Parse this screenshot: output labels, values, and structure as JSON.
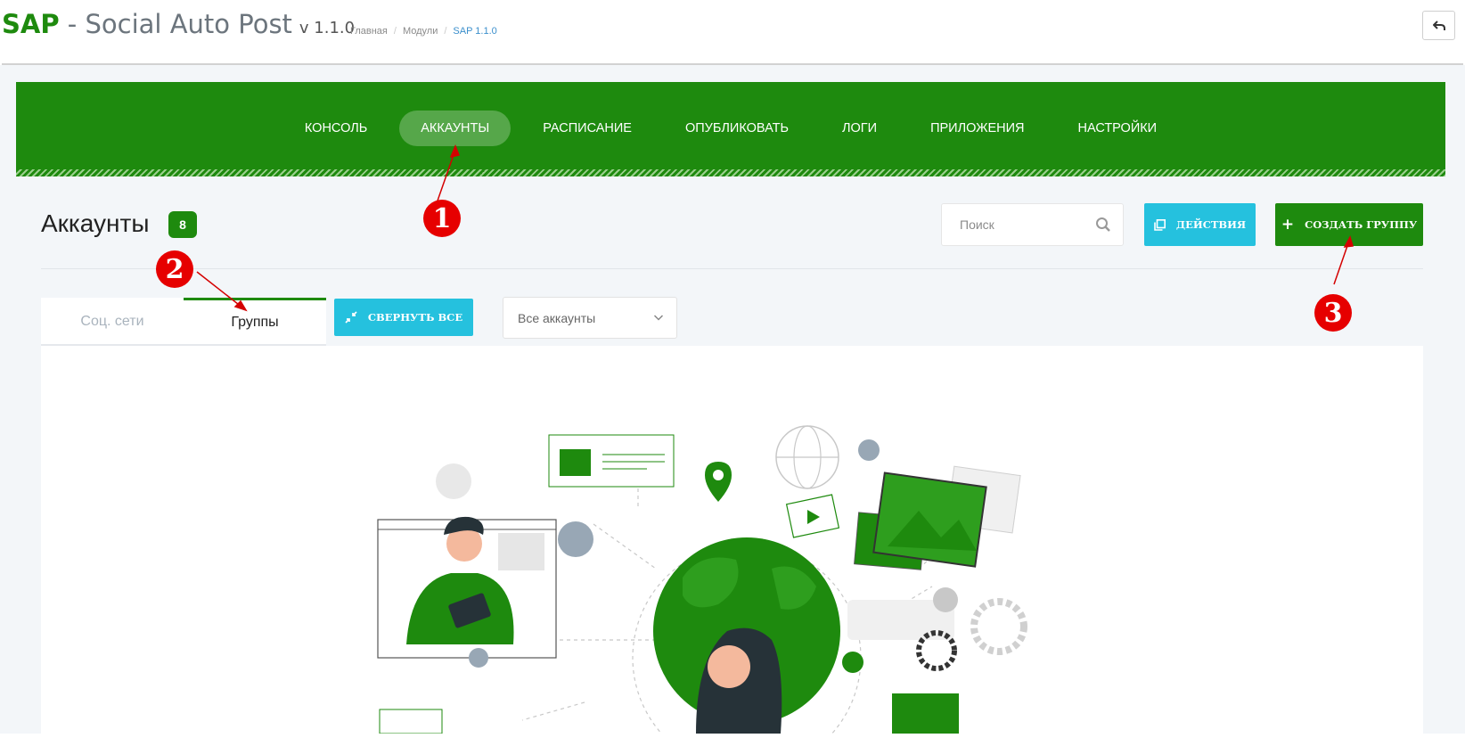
{
  "header": {
    "brand": "SAP",
    "title_rest": " - Social Auto Post",
    "version": "v 1.1.0",
    "breadcrumbs": [
      "Главная",
      "Модули",
      "SAP 1.1.0"
    ]
  },
  "nav": {
    "items": [
      "КОНСОЛЬ",
      "АККАУНТЫ",
      "РАСПИСАНИЕ",
      "ОПУБЛИКОВАТЬ",
      "ЛОГИ",
      "ПРИЛОЖЕНИЯ",
      "НАСТРОЙКИ"
    ],
    "active": "АККАУНТЫ"
  },
  "page": {
    "title": "Аккаунты",
    "count": "8"
  },
  "search": {
    "placeholder": "Поиск"
  },
  "actions": {
    "actions_label": "ДЕЙСТВИЯ",
    "create_group_label": "СОЗДАТЬ ГРУППУ",
    "collapse_label": "СВЕРНУТЬ ВСЕ"
  },
  "tabs": {
    "social": "Соц. сети",
    "groups": "Группы",
    "active": "Группы"
  },
  "filter": {
    "selected": "Все аккаунты"
  },
  "annotations": [
    "1",
    "2",
    "3"
  ],
  "colors": {
    "brand_green": "#1e8a0e",
    "accent_cyan": "#25c1de",
    "annotation_red": "#e60000"
  }
}
